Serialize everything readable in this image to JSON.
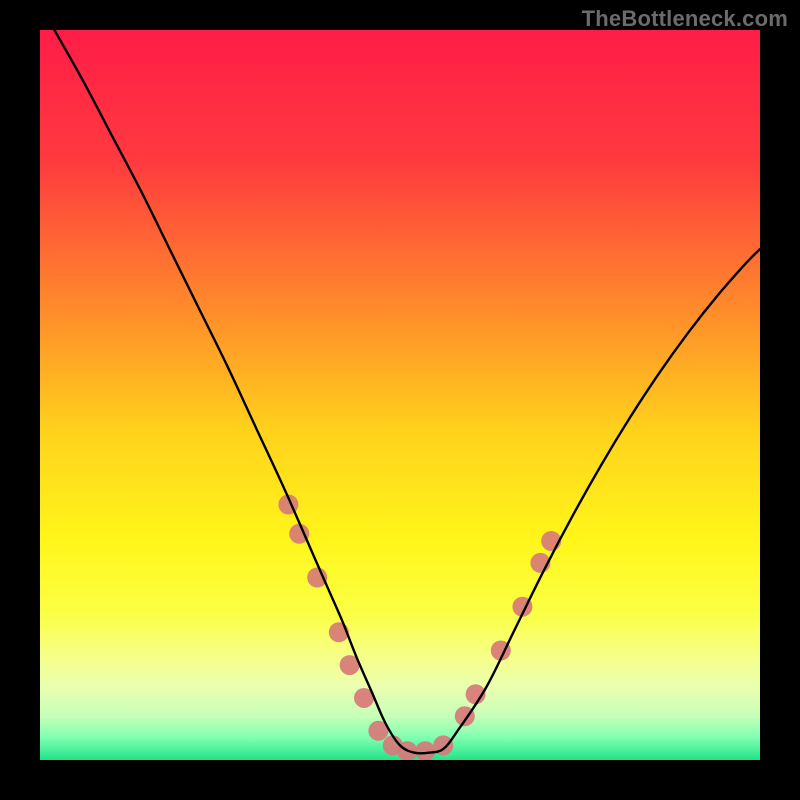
{
  "watermark": "TheBottleneck.com",
  "chart_data": {
    "type": "line",
    "title": "",
    "xlabel": "",
    "ylabel": "",
    "xlim": [
      0,
      100
    ],
    "ylim": [
      0,
      100
    ],
    "grid": false,
    "legend": false,
    "background_gradient": {
      "stops": [
        {
          "pos": 0.0,
          "color": "#ff1d47"
        },
        {
          "pos": 0.18,
          "color": "#ff3a3f"
        },
        {
          "pos": 0.38,
          "color": "#ff8a2b"
        },
        {
          "pos": 0.55,
          "color": "#ffd21c"
        },
        {
          "pos": 0.7,
          "color": "#fff61a"
        },
        {
          "pos": 0.8,
          "color": "#fbff45"
        },
        {
          "pos": 0.86,
          "color": "#f6ff8a"
        },
        {
          "pos": 0.9,
          "color": "#eaffb0"
        },
        {
          "pos": 0.94,
          "color": "#c6ffb8"
        },
        {
          "pos": 0.97,
          "color": "#7dffb0"
        },
        {
          "pos": 1.0,
          "color": "#22e38a"
        }
      ]
    },
    "series": [
      {
        "name": "bottleneck-curve",
        "color": "#000000",
        "x": [
          2,
          6,
          10,
          14,
          18,
          22,
          26,
          30,
          34,
          38,
          40,
          42,
          44,
          46,
          48,
          50,
          52,
          54,
          56,
          58,
          62,
          66,
          70,
          74,
          78,
          82,
          86,
          90,
          94,
          98,
          100
        ],
        "y": [
          100,
          93,
          85.5,
          78,
          70,
          62,
          54,
          45.5,
          37,
          28,
          23.5,
          19,
          14,
          9.5,
          5,
          2,
          1,
          1,
          1.5,
          4,
          10,
          18,
          26,
          33.5,
          40.5,
          47,
          53,
          58.5,
          63.5,
          68,
          70
        ]
      }
    ],
    "markers": {
      "name": "highlight-dots",
      "color": "#d77a78",
      "radius": 10,
      "points": [
        {
          "x": 34.5,
          "y": 35
        },
        {
          "x": 36.0,
          "y": 31
        },
        {
          "x": 38.5,
          "y": 25
        },
        {
          "x": 41.5,
          "y": 17.5
        },
        {
          "x": 43.0,
          "y": 13
        },
        {
          "x": 45.0,
          "y": 8.5
        },
        {
          "x": 47.0,
          "y": 4
        },
        {
          "x": 49.0,
          "y": 2
        },
        {
          "x": 51.0,
          "y": 1.2
        },
        {
          "x": 53.5,
          "y": 1.2
        },
        {
          "x": 56.0,
          "y": 2
        },
        {
          "x": 59.0,
          "y": 6
        },
        {
          "x": 60.5,
          "y": 9
        },
        {
          "x": 64.0,
          "y": 15
        },
        {
          "x": 67.0,
          "y": 21
        },
        {
          "x": 69.5,
          "y": 27
        },
        {
          "x": 71.0,
          "y": 30
        }
      ]
    }
  }
}
